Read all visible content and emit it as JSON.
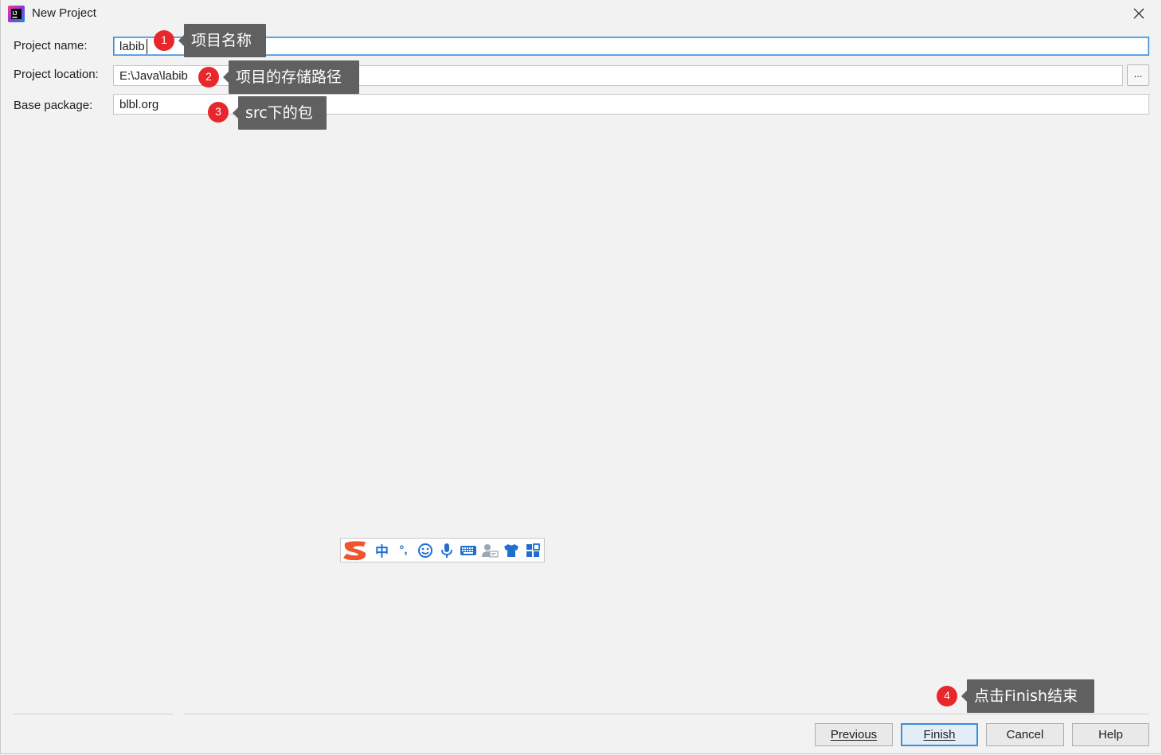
{
  "window": {
    "title": "New Project",
    "icon": "intellij-app-icon"
  },
  "form": {
    "project_name": {
      "label": "Project name:",
      "value": "labib"
    },
    "project_location": {
      "label": "Project location:",
      "value": "E:\\Java\\labib",
      "browse_label": "..."
    },
    "base_package": {
      "label": "Base package:",
      "value": "blbl.org"
    }
  },
  "annotations": [
    {
      "number": "1",
      "text": "项目名称"
    },
    {
      "number": "2",
      "text": "项目的存储路径"
    },
    {
      "number": "3",
      "text": "src下的包"
    },
    {
      "number": "4",
      "text": "点击Finish结束"
    }
  ],
  "ime_toolbar": {
    "mode_label": "中",
    "punct_label": "°,",
    "items": [
      "sogou-logo-icon",
      "chinese-mode-icon",
      "punctuation-icon",
      "emoji-icon",
      "microphone-icon",
      "keyboard-icon",
      "user-card-icon",
      "skin-shirt-icon",
      "toolbox-grid-icon"
    ]
  },
  "buttons": {
    "previous": "Previous",
    "finish": "Finish",
    "cancel": "Cancel",
    "help": "Help"
  },
  "colors": {
    "accent": "#3d8fd6",
    "marker": "#e8272c",
    "callout": "#606060",
    "background": "#f2f2f2"
  }
}
